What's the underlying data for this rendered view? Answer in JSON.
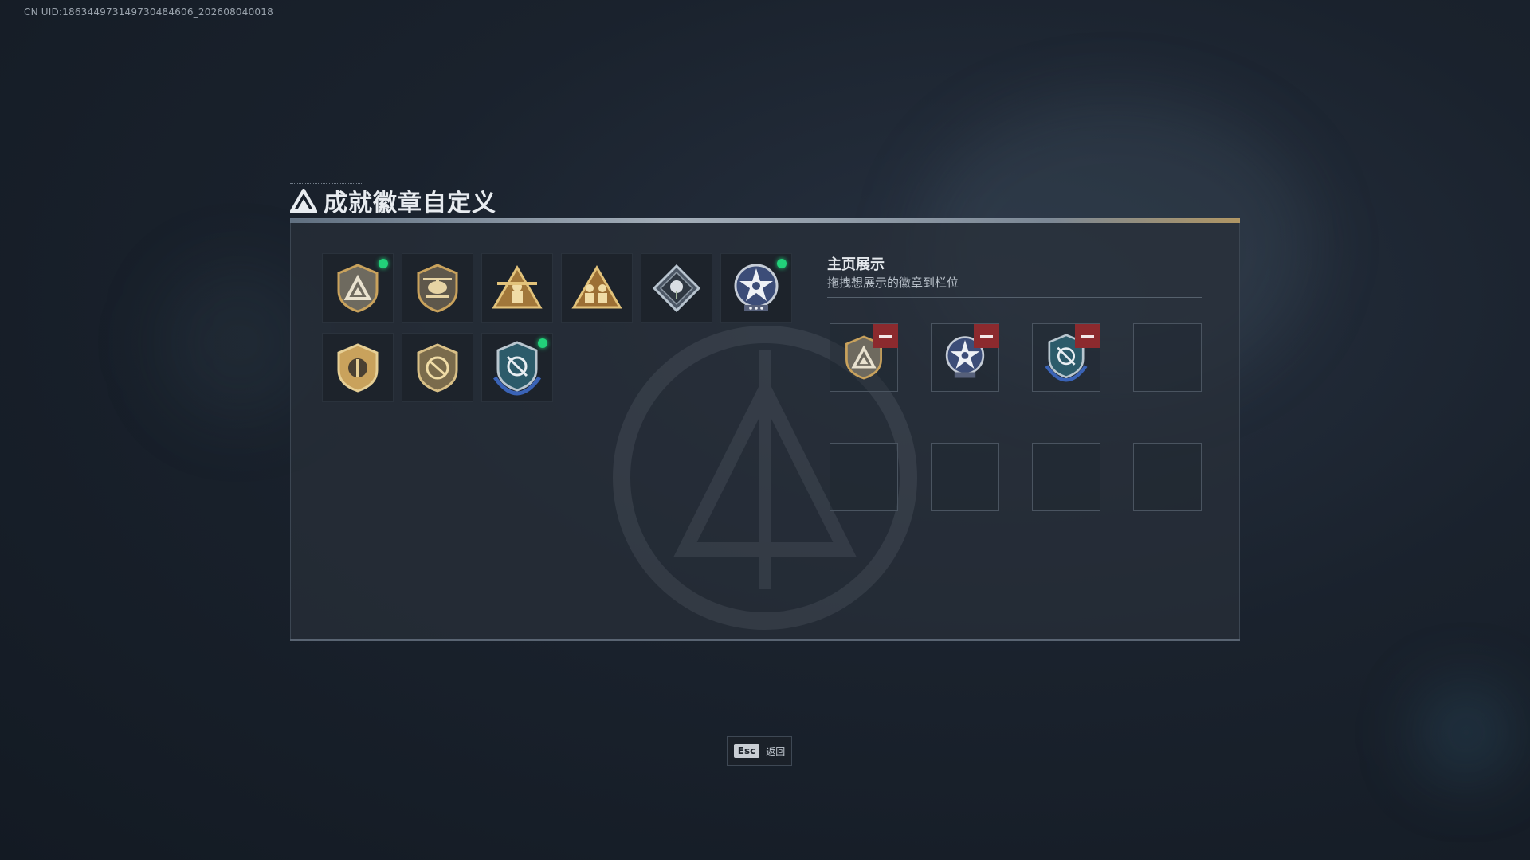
{
  "uid": "CN UID:186344973149730484606_202608040018",
  "page": {
    "title": "成就徽章自定义"
  },
  "badges": [
    {
      "icon": "shield-triangle-badge-icon",
      "new": true
    },
    {
      "icon": "helicopter-badge-icon",
      "new": false
    },
    {
      "icon": "gold-triangle-soldier-badge-icon",
      "new": false
    },
    {
      "icon": "gold-triangle-squad-badge-icon",
      "new": false
    },
    {
      "icon": "diamond-rose-badge-icon",
      "new": false
    },
    {
      "icon": "star-medal-badge-icon",
      "new": true
    },
    {
      "icon": "shield-circle-badge-icon",
      "new": false
    },
    {
      "icon": "shield-no-rifle-badge-icon",
      "new": false
    },
    {
      "icon": "blue-shield-wings-badge-icon",
      "new": true
    }
  ],
  "display": {
    "title": "主页展示",
    "subtitle": "拖拽想展示的徽章到栏位",
    "slots": [
      {
        "icon": "shield-triangle-badge-icon",
        "filled": true
      },
      {
        "icon": "star-medal-badge-icon",
        "filled": true
      },
      {
        "icon": "blue-shield-wings-badge-icon",
        "filled": true
      },
      {
        "icon": "",
        "filled": false
      },
      {
        "icon": "",
        "filled": false
      },
      {
        "icon": "",
        "filled": false
      },
      {
        "icon": "",
        "filled": false
      },
      {
        "icon": "",
        "filled": false
      }
    ]
  },
  "footer": {
    "key": "Esc",
    "label": "返回"
  },
  "colors": {
    "accent_green": "#22d27a",
    "remove_red": "#8c2a2e",
    "panel_bg": "#282f39",
    "gold": "#c9a25c"
  }
}
